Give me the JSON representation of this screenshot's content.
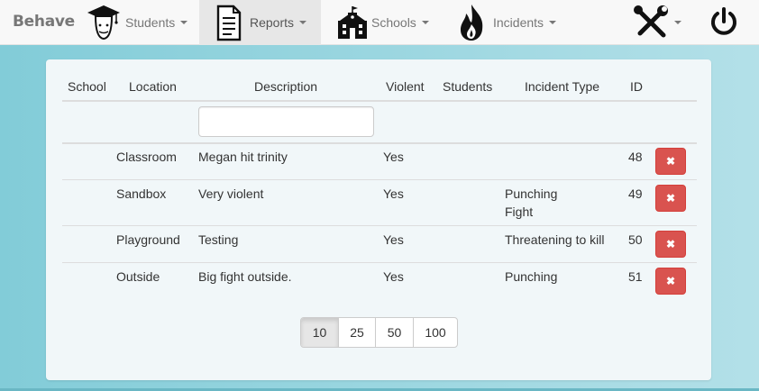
{
  "brand": "Behave",
  "nav": {
    "students": "Students",
    "reports": "Reports",
    "schools": "Schools",
    "incidents": "Incidents",
    "icons": {
      "students": "graduation-cap-student-icon",
      "reports": "document-icon",
      "schools": "schoolhouse-icon",
      "incidents": "fire-icon",
      "tools": "wrench-screwdriver-icon",
      "power": "power-icon"
    }
  },
  "table": {
    "headers": [
      "School",
      "Location",
      "Description",
      "Violent",
      "Students",
      "Incident Type",
      "ID"
    ],
    "filter_value": "",
    "rows": [
      {
        "school": "",
        "location": "Classroom",
        "description": "Megan hit trinity",
        "violent": "Yes",
        "students": "",
        "type1": "",
        "type2": "",
        "id": "48"
      },
      {
        "school": "",
        "location": "Sandbox",
        "description": "Very violent",
        "violent": "Yes",
        "students": "",
        "type1": "Punching",
        "type2": "Fight",
        "id": "49"
      },
      {
        "school": "",
        "location": "Playground",
        "description": "Testing",
        "violent": "Yes",
        "students": "",
        "type1": "Threatening to kill",
        "type2": "",
        "id": "50"
      },
      {
        "school": "",
        "location": "Outside",
        "description": "Big fight outside.",
        "violent": "Yes",
        "students": "",
        "type1": "Punching",
        "type2": "",
        "id": "51"
      }
    ],
    "delete_glyph": "✖"
  },
  "pagination": {
    "sizes": [
      "10",
      "25",
      "50",
      "100"
    ],
    "active": "10"
  },
  "colors": {
    "danger": "#d9534f",
    "navbar": "#f8f8f8",
    "background": "#9fd8e2"
  }
}
